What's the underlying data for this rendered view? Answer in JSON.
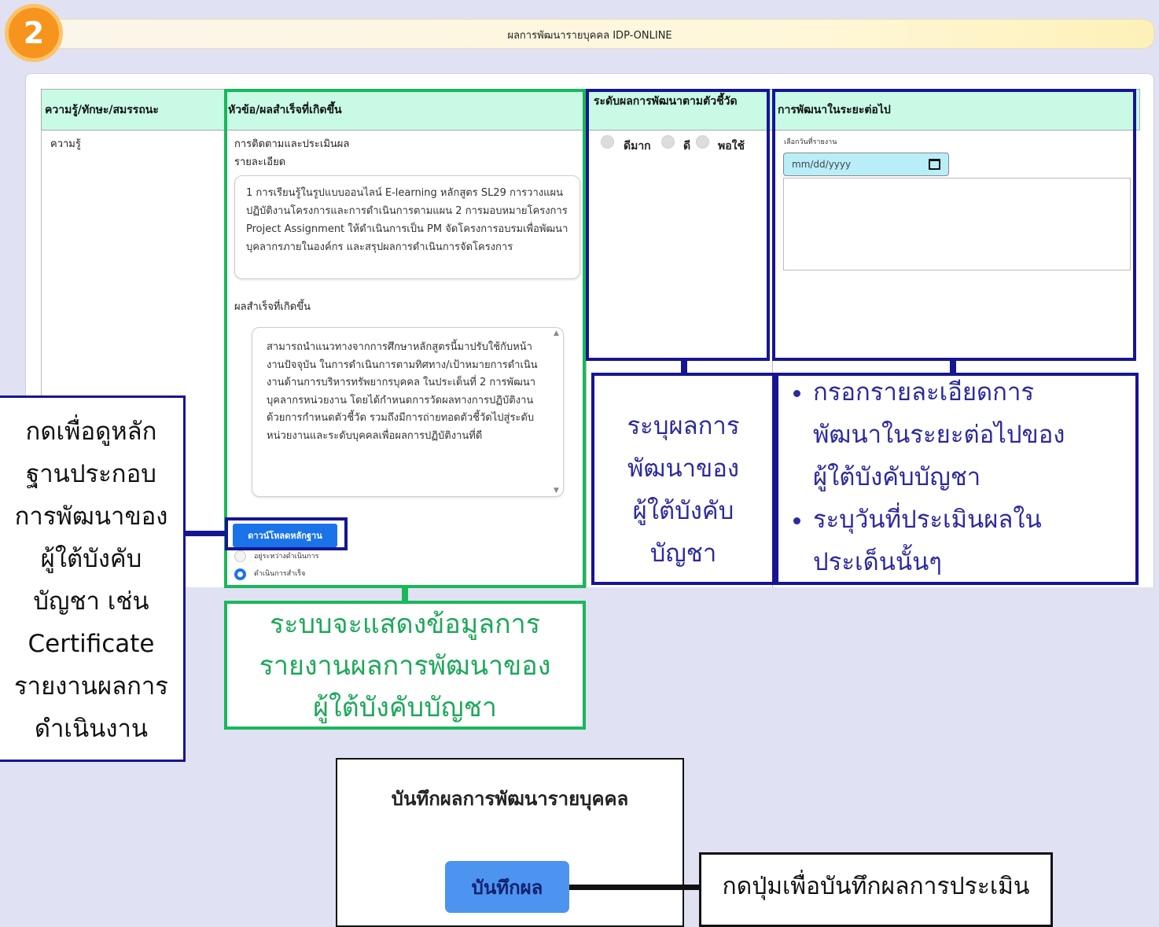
{
  "step_number": "2",
  "header": {
    "title": "ผลการพัฒนารายบุคคล IDP-ONLINE"
  },
  "table": {
    "columns": [
      "ความรู้/ทักษะ/สมรรถนะ",
      "หัวข้อ/ผลสำเร็จที่เกิดขึ้น",
      "ระดับผลการพัฒนาตามตัวชี้วัด",
      "การพัฒนาในระยะต่อไป"
    ],
    "row": {
      "category": "ความรู้",
      "topic_title": "การติดตามและประเมินผล",
      "detail_label": "รายละเอียด",
      "detail_text": "1 การเรียนรู้ในรูปแบบออนไลน์ E-learning หลักสูตร SL29 การวางแผนปฏิบัติงานโครงการและการดำเนินการตามแผน 2 การมอบหมายโครงการ Project Assignment ให้ดำเนินการเป็น PM จัดโครงการอบรมเพื่อพัฒนาบุคลากรภายในองค์กร และสรุปผลการดำเนินการจัดโครงการ",
      "result_label": "ผลสำเร็จที่เกิดขึ้น",
      "result_text": "สามารถนำแนวทางจากการศึกษาหลักสูตรนี้มาปรับใช้กับหน้างานปัจจุบัน ในการดำเนินการตามทิศทาง/เป้าหมายการดำเนินงานด้านการบริหารทรัพยากรบุคคล ในประเด็นที่ 2 การพัฒนาบุคลากรหน่วยงาน โดยได้กำหนดการวัดผลทางการปฏิบัติงานด้วยการกำหนดตัวชี้วัด รวมถึงมีการถ่ายทอดตัวชี้วัดไปสู่ระดับหน่วยงานและระดับบุคคลเพื่อผลการปฏิบัติงานที่ดี",
      "download_button": "ดาวน์โหลดหลักฐาน",
      "status_options": [
        "อยู่ระหว่างดำเนินการ",
        "ดำเนินการสำเร็จ"
      ],
      "status_selected": "ดำเนินการสำเร็จ",
      "rating_options": [
        "ดีมาก",
        "ดี",
        "พอใช้"
      ],
      "date_label": "เลือกวันที่รายงาน",
      "date_placeholder": "mm/dd/yyyy",
      "next_dev_text": ""
    }
  },
  "annotations": {
    "left_callout": [
      "กดเพื่อดูหลัก",
      "ฐานประกอบ",
      "การพัฒนาของ",
      "ผู้ใต้บังคับ",
      "บัญชา เช่น",
      "Certificate",
      "รายงานผลการ",
      "ดำเนินงาน"
    ],
    "green_callout": [
      "ระบบจะแสดงข้อมูลการ",
      "รายงานผลการพัฒนาของ",
      "ผู้ใต้บังคับบัญชา"
    ],
    "rating_callout": [
      "ระบุผลการ",
      "พัฒนาของ",
      "ผู้ใต้บังคับ",
      "บัญชา"
    ],
    "next_dev_callout": {
      "bullet1": [
        "กรอกรายละเอียดการ",
        "พัฒนาในระยะต่อไปของ",
        "ผู้ใต้บังคับบัญชา"
      ],
      "bullet2": [
        "ระบุวันที่ประเมินผลใน",
        "ประเด็นนั้นๆ"
      ]
    },
    "save_callout": "กดปุ่มเพื่อบันทึกผลการประเมิน"
  },
  "save_panel": {
    "title": "บันทึกผลการพัฒนารายบุคคล",
    "button": "บันทึกผล"
  },
  "colors": {
    "annotation_green": "#19b85a",
    "annotation_navy": "#171594",
    "table_header": "#c8fae6",
    "primary_button": "#1a73e8",
    "step_badge": "#f7941d"
  }
}
